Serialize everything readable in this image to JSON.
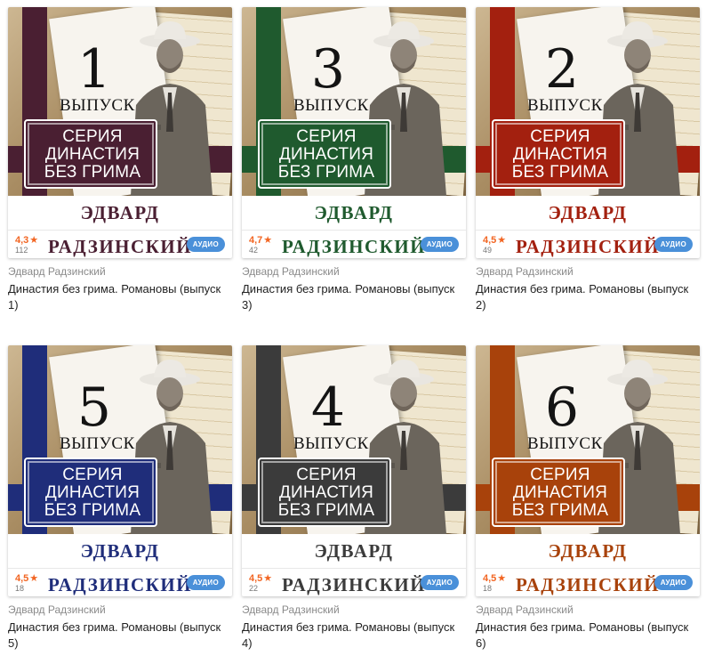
{
  "cards": [
    {
      "number": "1",
      "issue_word": "ВЫПУСК",
      "series": [
        "СЕРИЯ",
        "ДИНАСТИЯ",
        "БЕЗ ГРИМА"
      ],
      "cover_author": "ЭДВАРД РАДЗИНСКИЙ",
      "rating": "4,3",
      "reviews": "112",
      "badge": "АУДИО",
      "author": "Эдвард Радзинский",
      "title": "Династия без грима. Романовы (выпуск 1)",
      "accent": "#4a1f32"
    },
    {
      "number": "3",
      "issue_word": "ВЫПУСК",
      "series": [
        "СЕРИЯ",
        "ДИНАСТИЯ",
        "БЕЗ ГРИМА"
      ],
      "cover_author": "ЭДВАРД РАДЗИНСКИЙ",
      "rating": "4,7",
      "reviews": "42",
      "badge": "АУДИО",
      "author": "Эдвард Радзинский",
      "title": "Династия без грима. Романовы (выпуск 3)",
      "accent": "#1f5a2e"
    },
    {
      "number": "2",
      "issue_word": "ВЫПУСК",
      "series": [
        "СЕРИЯ",
        "ДИНАСТИЯ",
        "БЕЗ ГРИМА"
      ],
      "cover_author": "ЭДВАРД РАДЗИНСКИЙ",
      "rating": "4,5",
      "reviews": "49",
      "badge": "АУДИО",
      "author": "Эдвард Радзинский",
      "title": "Династия без грима. Романовы (выпуск 2)",
      "accent": "#a3200f"
    },
    {
      "number": "5",
      "issue_word": "ВЫПУСК",
      "series": [
        "СЕРИЯ",
        "ДИНАСТИЯ",
        "БЕЗ ГРИМА"
      ],
      "cover_author": "ЭДВАРД РАДЗИНСКИЙ",
      "rating": "4,5",
      "reviews": "18",
      "badge": "АУДИО",
      "author": "Эдвард Радзинский",
      "title": "Династия без грима. Романовы (выпуск 5)",
      "accent": "#1f2d7a"
    },
    {
      "number": "4",
      "issue_word": "ВЫПУСК",
      "series": [
        "СЕРИЯ",
        "ДИНАСТИЯ",
        "БЕЗ ГРИМА"
      ],
      "cover_author": "ЭДВАРД РАДЗИНСКИЙ",
      "rating": "4,5",
      "reviews": "22",
      "badge": "АУДИО",
      "author": "Эдвард Радзинский",
      "title": "Династия без грима. Романовы (выпуск 4)",
      "accent": "#3b3b3b"
    },
    {
      "number": "6",
      "issue_word": "ВЫПУСК",
      "series": [
        "СЕРИЯ",
        "ДИНАСТИЯ",
        "БЕЗ ГРИМА"
      ],
      "cover_author": "ЭДВАРД РАДЗИНСКИЙ",
      "rating": "4,5",
      "reviews": "18",
      "badge": "АУДИО",
      "author": "Эдвард Радзинский",
      "title": "Династия без грима. Романовы (выпуск 6)",
      "accent": "#a8420b"
    }
  ],
  "icons": {
    "rating_star": "star-icon"
  },
  "colors": {
    "rating": "#f26522",
    "badge": "#4a90d9"
  }
}
